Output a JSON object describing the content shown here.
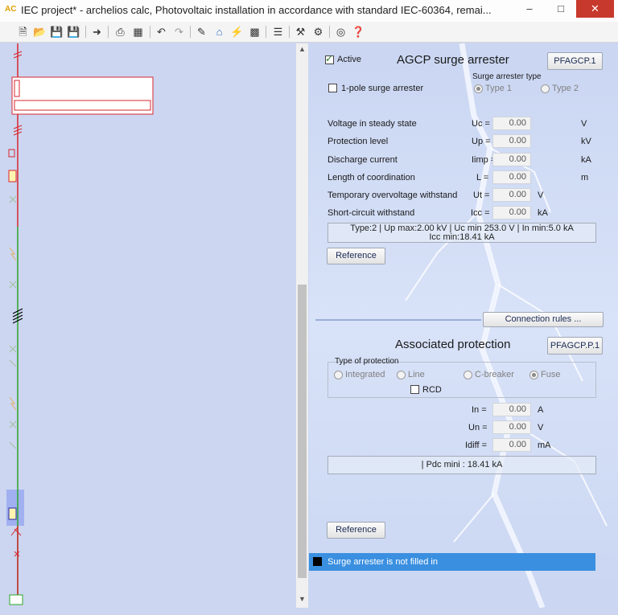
{
  "window": {
    "logo": "AC",
    "title": "IEC project* - archelios calc, Photovoltaic installation in accordance with standard IEC-60364, remai...",
    "minimize": "–",
    "maximize": "□",
    "close": "✕"
  },
  "toolbar": {
    "icons": [
      "new-icon",
      "open-icon",
      "save-icon",
      "save-as-icon",
      "import-icon",
      "print-icon",
      "export-icon",
      "undo-icon",
      "redo-icon",
      "edit-icon",
      "home-icon",
      "lightning-icon",
      "chart-icon",
      "database-icon",
      "tools-icon",
      "settings-icon",
      "support-icon",
      "help-icon"
    ]
  },
  "arrester": {
    "active_label": "Active",
    "active_checked": true,
    "title": "AGCP surge arrester",
    "code_button": "PFAGCP.1",
    "one_pole_label": "1-pole surge arrester",
    "type_group_label": "Surge arrester type",
    "type1": "Type 1",
    "type2": "Type 2",
    "rows": [
      {
        "label": "Voltage in steady state",
        "symbol": "Uc =",
        "value": "0.00",
        "unit": "V"
      },
      {
        "label": "Protection level",
        "symbol": "Up =",
        "value": "0.00",
        "unit": "kV"
      },
      {
        "label": "Discharge current",
        "symbol": "Iimp =",
        "value": "0.00",
        "unit": "kA"
      },
      {
        "label": "Length of coordination",
        "symbol": "L =",
        "value": "0.00",
        "unit": "m"
      },
      {
        "label": "Temporary overvoltage withstand",
        "symbol": "Ut =",
        "value": "0.00",
        "unit": "V"
      },
      {
        "label": "Short-circuit withstand",
        "symbol": "Icc =",
        "value": "0.00",
        "unit": "kA"
      }
    ],
    "info_line1": "Type:2 | Up max:2.00 kV | Uc min 253.0 V | In min:5.0 kA",
    "info_line2": "Icc min:18.41 kA",
    "reference_button": "Reference"
  },
  "connection_rules_button": "Connection rules ...",
  "protection": {
    "title": "Associated protection",
    "code_button": "PFAGCP.P.1",
    "type_label": "Type of protection",
    "options": [
      "Integrated",
      "Line",
      "C-breaker",
      "Fuse"
    ],
    "selected": "Fuse",
    "rcd_label": "RCD",
    "rows": [
      {
        "symbol": "In =",
        "value": "0.00",
        "unit": "A"
      },
      {
        "symbol": "Un =",
        "value": "0.00",
        "unit": "V"
      },
      {
        "symbol": "Idiff =",
        "value": "0.00",
        "unit": "mA"
      }
    ],
    "info": "| Pdc mini : 18.41 kA",
    "reference_button": "Reference"
  },
  "status": {
    "message": "Surge arrester is not filled in"
  },
  "colors": {
    "status_bar": "#3a8fe0",
    "ac_line": "#d8262e",
    "dc_line": "#2aa52a",
    "selection": "#6c7fe6"
  }
}
